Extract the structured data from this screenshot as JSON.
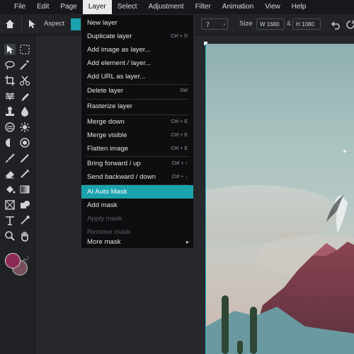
{
  "menubar": {
    "items": [
      "File",
      "Edit",
      "Page",
      "Layer",
      "Select",
      "Adjustment",
      "Filter",
      "Animation",
      "View",
      "Help"
    ],
    "active": "Layer"
  },
  "options": {
    "aspect_label": "Aspect",
    "num_field": "7",
    "size_label": "Size",
    "width_value": "W 1680",
    "height_value": "H 1080",
    "link_symbol": "&"
  },
  "layer_menu": {
    "items": [
      {
        "label": "New layer",
        "shortcut": ""
      },
      {
        "label": "Duplicate layer",
        "shortcut": "Ctrl + D"
      },
      {
        "label": "Add image as layer...",
        "shortcut": ""
      },
      {
        "label": "Add element / layer...",
        "shortcut": ""
      },
      {
        "label": "Add URL as layer...",
        "shortcut": ""
      },
      {
        "label": "Delete layer",
        "shortcut": "Del"
      },
      {
        "label": "Rasterize layer",
        "shortcut": ""
      },
      {
        "label": "Merge down",
        "shortcut": "Ctrl + E"
      },
      {
        "label": "Merge visible",
        "shortcut": "Ctrl + E"
      },
      {
        "label": "Flatten image",
        "shortcut": "Ctrl + E"
      },
      {
        "label": "Bring forward / up",
        "shortcut": "Ctrl + ↑"
      },
      {
        "label": "Send backward / down",
        "shortcut": "Ctrl + ↓"
      },
      {
        "label": "AI Auto Mask",
        "shortcut": ""
      },
      {
        "label": "Add mask",
        "shortcut": ""
      },
      {
        "label": "Apply mask",
        "shortcut": ""
      },
      {
        "label": "Remove mask",
        "shortcut": ""
      },
      {
        "label": "More mask",
        "shortcut": ""
      }
    ],
    "highlighted": "AI Auto Mask",
    "disabled": [
      "Apply mask",
      "Remove mask"
    ]
  },
  "colors": {
    "accent": "#1aa3ad",
    "foreground": "#8c2a55",
    "background": "#77505c"
  },
  "icons": {
    "toolbar_left": [
      "move-icon",
      "lasso-icon",
      "crop-icon",
      "heal-icon",
      "stamp-icon",
      "blur-icon",
      "dodge-icon",
      "brush-icon",
      "eraser-icon",
      "bucket-icon",
      "frame-icon",
      "text-icon",
      "zoom-icon"
    ],
    "toolbar_right": [
      "marquee-icon",
      "wand-icon",
      "slice-icon",
      "pen-icon",
      "drop-icon",
      "sharpen-icon",
      "sponge-icon",
      "pencil-icon",
      "replace-color-icon",
      "gradient-icon",
      "shape-icon",
      "eyedropper-icon",
      "hand-icon"
    ]
  }
}
